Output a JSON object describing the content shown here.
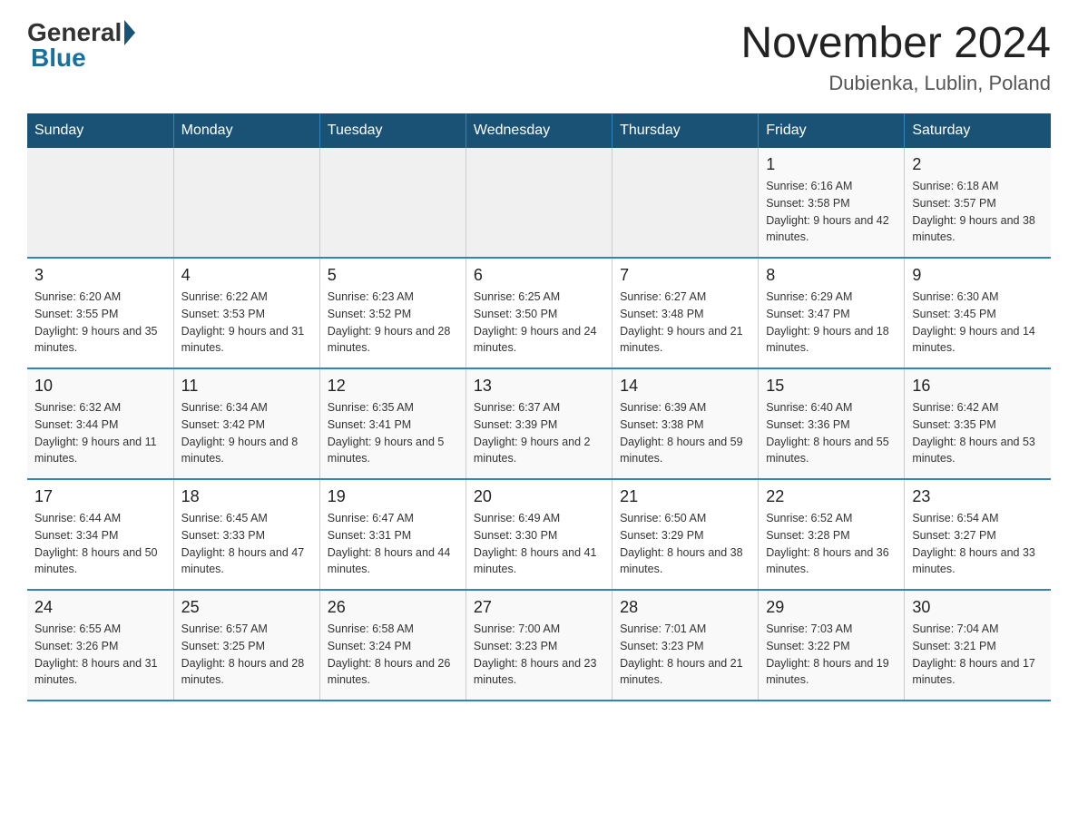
{
  "logo": {
    "general": "General",
    "blue": "Blue"
  },
  "title": "November 2024",
  "location": "Dubienka, Lublin, Poland",
  "days_of_week": [
    "Sunday",
    "Monday",
    "Tuesday",
    "Wednesday",
    "Thursday",
    "Friday",
    "Saturday"
  ],
  "weeks": [
    [
      {
        "day": "",
        "info": ""
      },
      {
        "day": "",
        "info": ""
      },
      {
        "day": "",
        "info": ""
      },
      {
        "day": "",
        "info": ""
      },
      {
        "day": "",
        "info": ""
      },
      {
        "day": "1",
        "info": "Sunrise: 6:16 AM\nSunset: 3:58 PM\nDaylight: 9 hours and 42 minutes."
      },
      {
        "day": "2",
        "info": "Sunrise: 6:18 AM\nSunset: 3:57 PM\nDaylight: 9 hours and 38 minutes."
      }
    ],
    [
      {
        "day": "3",
        "info": "Sunrise: 6:20 AM\nSunset: 3:55 PM\nDaylight: 9 hours and 35 minutes."
      },
      {
        "day": "4",
        "info": "Sunrise: 6:22 AM\nSunset: 3:53 PM\nDaylight: 9 hours and 31 minutes."
      },
      {
        "day": "5",
        "info": "Sunrise: 6:23 AM\nSunset: 3:52 PM\nDaylight: 9 hours and 28 minutes."
      },
      {
        "day": "6",
        "info": "Sunrise: 6:25 AM\nSunset: 3:50 PM\nDaylight: 9 hours and 24 minutes."
      },
      {
        "day": "7",
        "info": "Sunrise: 6:27 AM\nSunset: 3:48 PM\nDaylight: 9 hours and 21 minutes."
      },
      {
        "day": "8",
        "info": "Sunrise: 6:29 AM\nSunset: 3:47 PM\nDaylight: 9 hours and 18 minutes."
      },
      {
        "day": "9",
        "info": "Sunrise: 6:30 AM\nSunset: 3:45 PM\nDaylight: 9 hours and 14 minutes."
      }
    ],
    [
      {
        "day": "10",
        "info": "Sunrise: 6:32 AM\nSunset: 3:44 PM\nDaylight: 9 hours and 11 minutes."
      },
      {
        "day": "11",
        "info": "Sunrise: 6:34 AM\nSunset: 3:42 PM\nDaylight: 9 hours and 8 minutes."
      },
      {
        "day": "12",
        "info": "Sunrise: 6:35 AM\nSunset: 3:41 PM\nDaylight: 9 hours and 5 minutes."
      },
      {
        "day": "13",
        "info": "Sunrise: 6:37 AM\nSunset: 3:39 PM\nDaylight: 9 hours and 2 minutes."
      },
      {
        "day": "14",
        "info": "Sunrise: 6:39 AM\nSunset: 3:38 PM\nDaylight: 8 hours and 59 minutes."
      },
      {
        "day": "15",
        "info": "Sunrise: 6:40 AM\nSunset: 3:36 PM\nDaylight: 8 hours and 55 minutes."
      },
      {
        "day": "16",
        "info": "Sunrise: 6:42 AM\nSunset: 3:35 PM\nDaylight: 8 hours and 53 minutes."
      }
    ],
    [
      {
        "day": "17",
        "info": "Sunrise: 6:44 AM\nSunset: 3:34 PM\nDaylight: 8 hours and 50 minutes."
      },
      {
        "day": "18",
        "info": "Sunrise: 6:45 AM\nSunset: 3:33 PM\nDaylight: 8 hours and 47 minutes."
      },
      {
        "day": "19",
        "info": "Sunrise: 6:47 AM\nSunset: 3:31 PM\nDaylight: 8 hours and 44 minutes."
      },
      {
        "day": "20",
        "info": "Sunrise: 6:49 AM\nSunset: 3:30 PM\nDaylight: 8 hours and 41 minutes."
      },
      {
        "day": "21",
        "info": "Sunrise: 6:50 AM\nSunset: 3:29 PM\nDaylight: 8 hours and 38 minutes."
      },
      {
        "day": "22",
        "info": "Sunrise: 6:52 AM\nSunset: 3:28 PM\nDaylight: 8 hours and 36 minutes."
      },
      {
        "day": "23",
        "info": "Sunrise: 6:54 AM\nSunset: 3:27 PM\nDaylight: 8 hours and 33 minutes."
      }
    ],
    [
      {
        "day": "24",
        "info": "Sunrise: 6:55 AM\nSunset: 3:26 PM\nDaylight: 8 hours and 31 minutes."
      },
      {
        "day": "25",
        "info": "Sunrise: 6:57 AM\nSunset: 3:25 PM\nDaylight: 8 hours and 28 minutes."
      },
      {
        "day": "26",
        "info": "Sunrise: 6:58 AM\nSunset: 3:24 PM\nDaylight: 8 hours and 26 minutes."
      },
      {
        "day": "27",
        "info": "Sunrise: 7:00 AM\nSunset: 3:23 PM\nDaylight: 8 hours and 23 minutes."
      },
      {
        "day": "28",
        "info": "Sunrise: 7:01 AM\nSunset: 3:23 PM\nDaylight: 8 hours and 21 minutes."
      },
      {
        "day": "29",
        "info": "Sunrise: 7:03 AM\nSunset: 3:22 PM\nDaylight: 8 hours and 19 minutes."
      },
      {
        "day": "30",
        "info": "Sunrise: 7:04 AM\nSunset: 3:21 PM\nDaylight: 8 hours and 17 minutes."
      }
    ]
  ]
}
